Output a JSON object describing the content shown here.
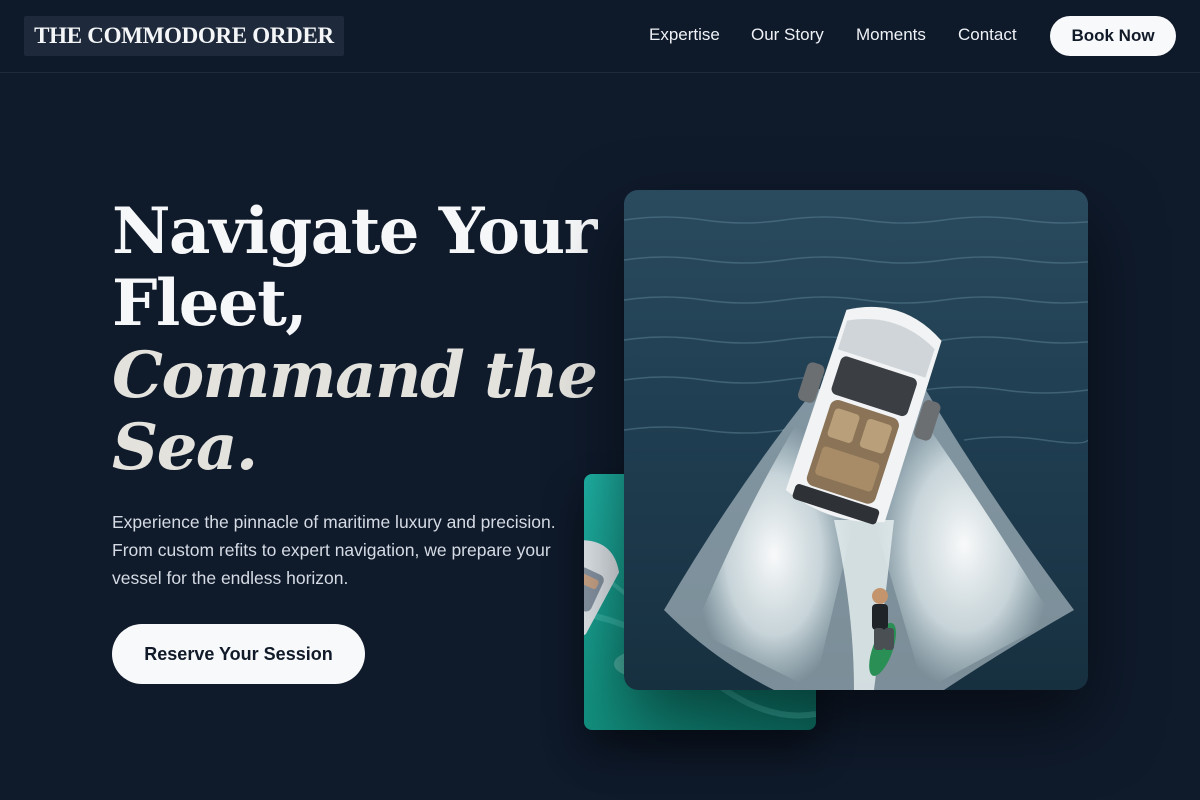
{
  "brand": {
    "name": "THE COMMODORE ORDER"
  },
  "nav": {
    "links": [
      {
        "label": "Expertise"
      },
      {
        "label": "Our Story"
      },
      {
        "label": "Moments"
      },
      {
        "label": "Contact"
      }
    ],
    "cta_label": "Book Now"
  },
  "hero": {
    "title_line1": "Navigate Your",
    "title_line2": "Fleet,",
    "title_line3": "Command the",
    "title_line4": "Sea.",
    "description": "Experience the pinnacle of maritime luxury and precision. From custom refits to expert navigation, we prepare your vessel for the endless horizon.",
    "cta_label": "Reserve Your Session"
  },
  "images": {
    "main": {
      "icon": "speedboat-wakeboarder-photo"
    },
    "secondary": {
      "icon": "boat-turquoise-water-photo"
    }
  },
  "colors": {
    "background": "#0f1a2b",
    "button_bg": "#f8f9fb",
    "button_text": "#111a28",
    "water_dark": "#1f3b4d",
    "water_teal": "#1aa39a"
  }
}
